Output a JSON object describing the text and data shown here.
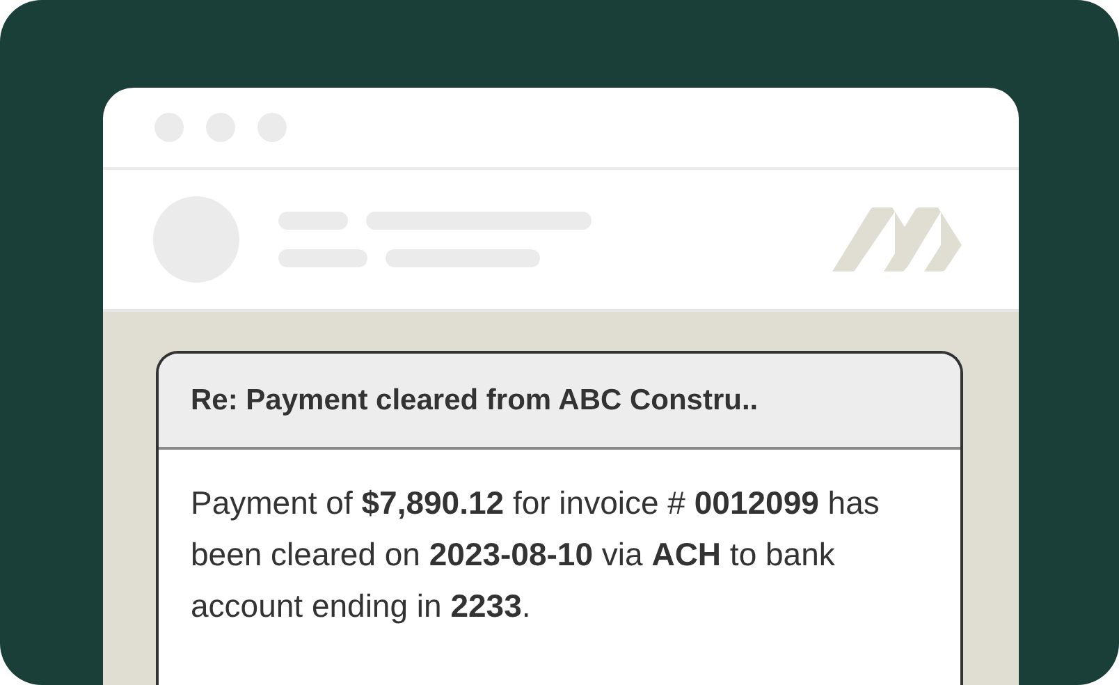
{
  "message": {
    "subject": "Re: Payment cleared from ABC Constru..",
    "body": "Payment of **$7,890.12** for invoice # **0012099** has been cleared on **2023-08-10** via **ACH** to bank account ending in **2233**."
  }
}
